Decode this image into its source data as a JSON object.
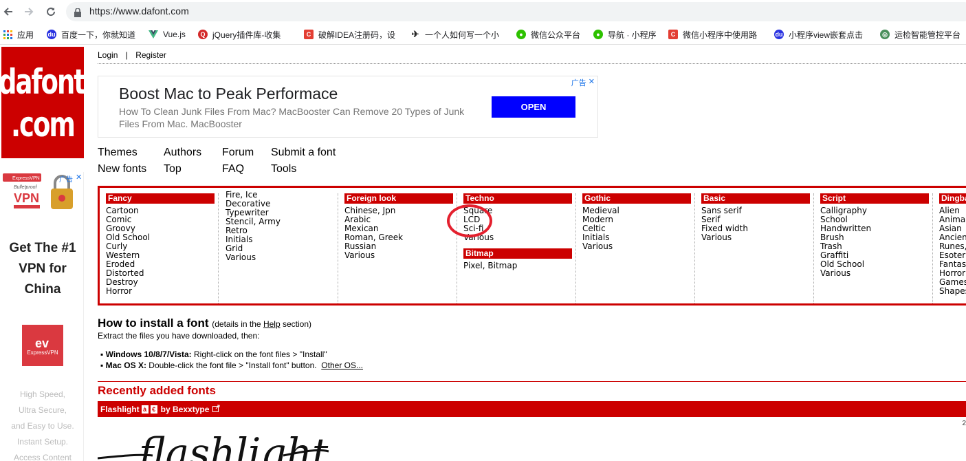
{
  "browser": {
    "url": "https://www.dafont.com",
    "bookmarks": [
      {
        "label": "应用",
        "icon": "apps-grid-icon"
      },
      {
        "label": "百度一下，你就知道",
        "icon": "baidu-paw-icon"
      },
      {
        "label": "Vue.js",
        "icon": "vue-logo-icon"
      },
      {
        "label": "jQuery插件库-收集",
        "icon": "jquery-icon"
      },
      {
        "label": "破解IDEA注册码，设",
        "icon": "csdn-icon"
      },
      {
        "label": "一个人如何写一个小",
        "icon": "bird-icon"
      },
      {
        "label": "微信公众平台",
        "icon": "wechat-icon"
      },
      {
        "label": "导航 · 小程序",
        "icon": "wechat-icon"
      },
      {
        "label": "微信小程序中使用路",
        "icon": "csdn-icon"
      },
      {
        "label": "小程序view嵌套点击",
        "icon": "baidu-paw-icon"
      },
      {
        "label": "运检智能管控平台",
        "icon": "globe-icon"
      }
    ]
  },
  "header": {
    "logo_line1": "dafont",
    "logo_line2": ".com",
    "login": "Login",
    "separator": "|",
    "register": "Register"
  },
  "ad": {
    "title": "Boost Mac to Peak Performace",
    "subtitle": "How To Clean Junk Files From Mac? MacBooster Can Remove 20 Types of Junk Files From Mac.",
    "brand": "MacBooster",
    "button": "OPEN",
    "tag": "广告"
  },
  "nav": {
    "themes": "Themes",
    "new_fonts": "New fonts",
    "authors": "Authors",
    "top": "Top",
    "forum": "Forum",
    "faq": "FAQ",
    "submit": "Submit a font",
    "tools": "Tools"
  },
  "side_ad": {
    "tag": "广告",
    "badge": "ExpressVPN",
    "bulletproof": "Bulletproof",
    "vpn": "VPN",
    "title_line1": "Get The #1",
    "title_line2": "VPN for",
    "title_line3": "China",
    "logo_text": "ExpressVPN",
    "line1": "High Speed,",
    "line2": "Ultra Secure,",
    "line3": "and Easy to Use.",
    "line4": "Instant Setup.",
    "line5": "Access Content"
  },
  "categories": {
    "fancy": {
      "title": "Fancy",
      "items": [
        "Cartoon",
        "Comic",
        "Groovy",
        "Old School",
        "Curly",
        "Western",
        "Eroded",
        "Distorted",
        "Destroy",
        "Horror"
      ]
    },
    "fancy2": {
      "items": [
        "Fire, Ice",
        "Decorative",
        "Typewriter",
        "Stencil, Army",
        "Retro",
        "Initials",
        "Grid",
        "Various"
      ]
    },
    "foreign": {
      "title": "Foreign look",
      "items": [
        "Chinese, Jpn",
        "Arabic",
        "Mexican",
        "Roman, Greek",
        "Russian",
        "Various"
      ]
    },
    "techno": {
      "title": "Techno",
      "items": [
        "Square",
        "LCD",
        "Sci-fi",
        "Various"
      ]
    },
    "bitmap": {
      "title": "Bitmap",
      "items": [
        "Pixel, Bitmap"
      ]
    },
    "gothic": {
      "title": "Gothic",
      "items": [
        "Medieval",
        "Modern",
        "Celtic",
        "Initials",
        "Various"
      ]
    },
    "basic": {
      "title": "Basic",
      "items": [
        "Sans serif",
        "Serif",
        "Fixed width",
        "Various"
      ]
    },
    "script": {
      "title": "Script",
      "items": [
        "Calligraphy",
        "School",
        "Handwritten",
        "Brush",
        "Trash",
        "Graffiti",
        "Old School",
        "Various"
      ]
    },
    "dingbats": {
      "title": "Dingbats",
      "items": [
        "Alien",
        "Animals",
        "Asian",
        "Ancient",
        "Runes, L",
        "Esoteric",
        "Fantastic",
        "Horror",
        "Games",
        "Shapes"
      ]
    }
  },
  "install": {
    "title": "How to install a font",
    "details_pre": "(details in the",
    "details_link": "Help",
    "details_post": "section)",
    "extract": "Extract the files you have downloaded, then:",
    "win_label": "Windows 10/8/7/Vista:",
    "win_text": "Right-click on the font files > \"Install\"",
    "mac_label": "Mac OS X:",
    "mac_text": "Double-click the font file > \"Install font\" button.",
    "other": "Other OS..."
  },
  "recent": {
    "title": "Recently added fonts",
    "font_name": "Flashlight",
    "by": "by",
    "author": "Bexxtype",
    "preview": "flashlight",
    "page_num": "2"
  },
  "colors": {
    "brand_red": "#cc0000",
    "ad_button": "#0000ff",
    "annotation_circle": "#e4202e"
  }
}
